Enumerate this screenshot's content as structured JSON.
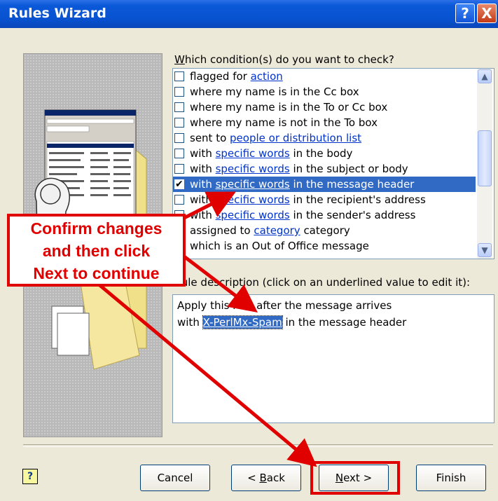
{
  "window": {
    "title": "Rules Wizard",
    "help_glyph": "?",
    "close_glyph": "X"
  },
  "conditions": {
    "heading": "Which condition(s) do you want to check?",
    "items": [
      {
        "pre": "flagged for ",
        "link": "action",
        "post": "",
        "checked": false,
        "selected": false
      },
      {
        "pre": "where my name is in the Cc box",
        "link": "",
        "post": "",
        "checked": false,
        "selected": false
      },
      {
        "pre": "where my name is in the To or Cc box",
        "link": "",
        "post": "",
        "checked": false,
        "selected": false
      },
      {
        "pre": "where my name is not in the To box",
        "link": "",
        "post": "",
        "checked": false,
        "selected": false
      },
      {
        "pre": "sent to ",
        "link": "people or distribution list",
        "post": "",
        "checked": false,
        "selected": false
      },
      {
        "pre": "with ",
        "link": "specific words",
        "post": " in the body",
        "checked": false,
        "selected": false
      },
      {
        "pre": "with ",
        "link": "specific words",
        "post": " in the subject or body",
        "checked": false,
        "selected": false
      },
      {
        "pre": "with ",
        "link": "specific words",
        "post": " in the message header",
        "checked": true,
        "selected": true
      },
      {
        "pre": "with ",
        "link": "specific words",
        "post": " in the recipient's address",
        "checked": false,
        "selected": false
      },
      {
        "pre": "with ",
        "link": "specific words",
        "post": " in the sender's address",
        "checked": false,
        "selected": false
      },
      {
        "pre": "assigned to ",
        "link": "category",
        "post": " category",
        "checked": false,
        "selected": false
      },
      {
        "pre": "which is an Out of Office message",
        "link": "",
        "post": "",
        "checked": false,
        "selected": false
      }
    ]
  },
  "description": {
    "heading": "Rule description (click on an underlined value to edit it):",
    "line1": "Apply this rule after the message arrives",
    "line2_pre": "with ",
    "line2_value": "X-PerlMx-Spam",
    "line2_post": " in the message header"
  },
  "buttons": {
    "help_glyph": "?",
    "cancel": "Cancel",
    "back_prefix": "< ",
    "back_key": "B",
    "back_rest": "ack",
    "next_key": "N",
    "next_rest": "ext >",
    "finish": "Finish"
  },
  "annotation": {
    "line1": "Confirm changes",
    "line2": "and then click",
    "line3": "Next to continue",
    "color": "#e00000"
  },
  "colors": {
    "selection": "#316ac5",
    "link": "#0033cc",
    "titlebar": "#0852cf"
  },
  "icons": {
    "check": "✔",
    "scroll_up": "▲",
    "scroll_down": "▼",
    "thumb_grip": "≡"
  }
}
